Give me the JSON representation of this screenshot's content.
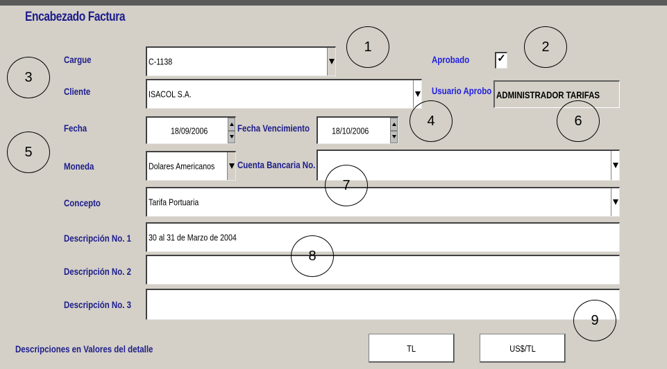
{
  "header": {
    "title": "Encabezado Factura"
  },
  "fields": {
    "cargue": {
      "label": "Cargue",
      "value": "C-1138"
    },
    "cliente": {
      "label": "Cliente",
      "value": "ISACOL S.A."
    },
    "fecha": {
      "label": "Fecha",
      "value": "18/09/2006"
    },
    "fecha_vencimiento": {
      "label": "Fecha Vencimiento",
      "value": "18/10/2006"
    },
    "moneda": {
      "label": "Moneda",
      "value": "Dolares Americanos"
    },
    "cuenta_bancaria": {
      "label": "Cuenta Bancaria No.",
      "value": ""
    },
    "concepto": {
      "label": "Concepto",
      "value": "Tarifa Portuaria"
    },
    "descripcion1": {
      "label": "Descripción No. 1",
      "value": "30 al 31 de Marzo de 2004"
    },
    "descripcion2": {
      "label": "Descripción No. 2",
      "value": ""
    },
    "descripcion3": {
      "label": "Descripción No. 3",
      "value": ""
    },
    "aprobado": {
      "label": "Aprobado",
      "checked": true,
      "mark": "✓"
    },
    "usuario_aprobo": {
      "label": "Usuario Aprobo",
      "value": "ADMINISTRADOR TARIFAS"
    }
  },
  "footer": {
    "label": "Descripciones en Valores del detalle",
    "btn_tl": "TL",
    "btn_usd": "US$/TL"
  },
  "callouts": [
    "1",
    "2",
    "3",
    "4",
    "5",
    "6",
    "7",
    "8",
    "9"
  ],
  "colors": {
    "label": "#1c1c8a",
    "label_highlight": "#2020e0",
    "background": "#d4d0c8"
  },
  "icons": [
    "dropdown-arrow-icon",
    "spin-up-icon",
    "spin-down-icon",
    "checkmark-icon"
  ]
}
